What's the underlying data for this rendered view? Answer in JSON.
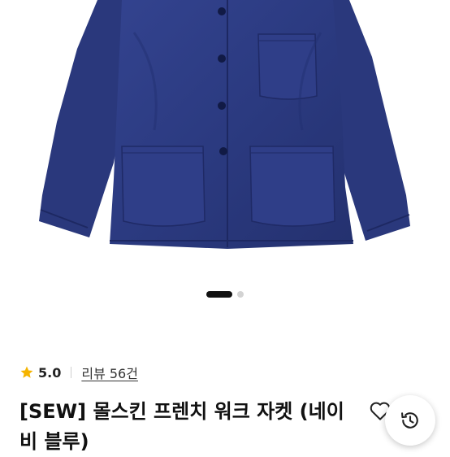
{
  "product": {
    "title": "[SEW] 몰스킨 프렌치 워크 자켓 (네이비 블루)",
    "image_alt": "navy work jacket"
  },
  "carousel": {
    "total": 2,
    "current": 1
  },
  "rating": {
    "score": "5.0",
    "review_link": "리뷰 56건"
  },
  "colors": {
    "jacket": "#2c3a82",
    "star": "#f5b400"
  },
  "icons": {
    "wishlist": "heart-outline-icon",
    "history": "history-icon",
    "star": "star-icon"
  }
}
